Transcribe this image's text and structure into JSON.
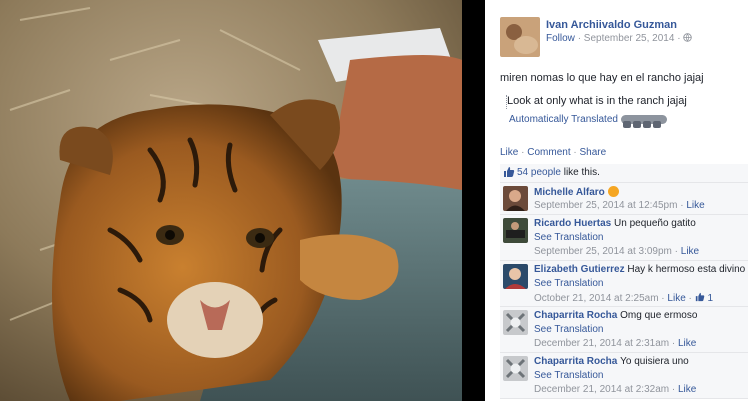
{
  "post": {
    "author": "Ivan Archiivaldo Guzman",
    "follow": "Follow",
    "date": "September 25, 2014",
    "text": "miren nomas lo que hay en el rancho jajaj",
    "translation": "Look at only what is in the ranch jajaj",
    "auto_translated": "Automatically Translated"
  },
  "actions": {
    "like": "Like",
    "comment": "Comment",
    "share": "Share"
  },
  "likes": {
    "count": "54 people",
    "suffix": "like this."
  },
  "comments": [
    {
      "name": "Michelle Alfaro",
      "text": "",
      "see_translation": "",
      "date": "September 25, 2014 at 12:45pm",
      "like": "Like",
      "likes": ""
    },
    {
      "name": "Ricardo Huertas",
      "text": "Un pequeño gatito",
      "see_translation": "See Translation",
      "date": "September 25, 2014 at 3:09pm",
      "like": "Like",
      "likes": ""
    },
    {
      "name": "Elizabeth Gutierrez",
      "text": "Hay k hermoso esta divino",
      "see_translation": "See Translation",
      "date": "October 21, 2014 at 2:25am",
      "like": "Like",
      "likes": "1"
    },
    {
      "name": "Chaparrita Rocha",
      "text": "Omg que ermoso",
      "see_translation": "See Translation",
      "date": "December 21, 2014 at 2:31am",
      "like": "Like",
      "likes": ""
    },
    {
      "name": "Chaparrita Rocha",
      "text": "Yo quisiera uno",
      "see_translation": "See Translation",
      "date": "December 21, 2014 at 2:32am",
      "like": "Like",
      "likes": ""
    }
  ],
  "colors": {
    "link": "#365899",
    "meta": "#90949c",
    "panel": "#f6f7f9"
  }
}
